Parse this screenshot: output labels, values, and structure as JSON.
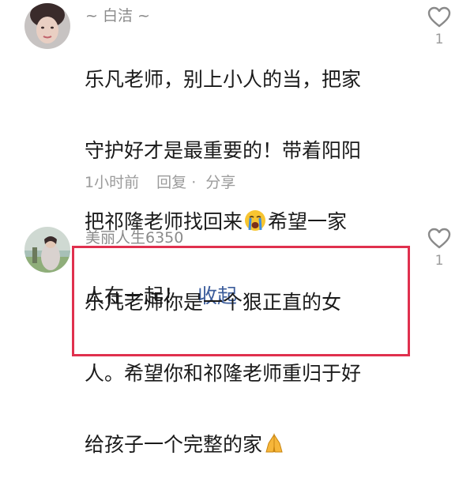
{
  "comments": [
    {
      "username": "~ 白洁 ~",
      "lines": [
        "乐凡老师，别上小人的当，把家",
        "守护好才是最重要的！带着阳阳",
        "把祁隆老师找回来",
        "人在一起！"
      ],
      "line3_suffix": "希望一家",
      "collapse_label": "收起",
      "time": "1小时前",
      "reply_label": "回复",
      "dot": "·",
      "share_label": "分享",
      "like_count": "1",
      "emoji": "crying-face"
    },
    {
      "username": "美丽人生6350",
      "lines": [
        "乐凡老师你是一个狠正直的女",
        "人。希望你和祁隆老师重归于好",
        "给孩子一个完整的家"
      ],
      "like_count": "1",
      "emoji": "folded-hands",
      "highlight_color": "#e0304e"
    }
  ]
}
